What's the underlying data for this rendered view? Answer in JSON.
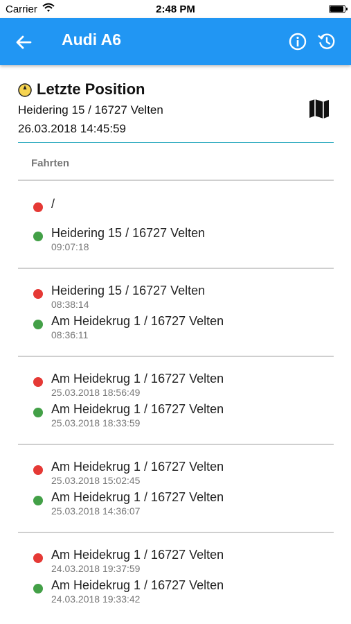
{
  "status_bar": {
    "carrier": "Carrier",
    "time": "2:48 PM",
    "battery_level": 1.0,
    "wifi_icon": "wifi-icon",
    "battery_icon": "battery-icon"
  },
  "app_bar": {
    "title": "Audi A6",
    "background_color": "#2196f3",
    "back_icon": "arrow-left-icon",
    "info_icon": "info-icon",
    "refresh_icon": "history-refresh-icon"
  },
  "last_position": {
    "title": "Letzte Position",
    "address": "Heidering 15 / 16727 Velten",
    "datetime": "26.03.2018 14:45:59",
    "status_icon": "yellow-location-icon",
    "map_icon": "map-icon",
    "accent_color": "#3ab0c3"
  },
  "trips": {
    "header": "Fahrten",
    "end_color": "#e53935",
    "start_color": "#43a047",
    "items": [
      {
        "end": {
          "address": "/",
          "time": ""
        },
        "start": {
          "address": "Heidering 15 / 16727 Velten",
          "time": "09:07:18"
        }
      },
      {
        "end": {
          "address": "Heidering 15 / 16727 Velten",
          "time": "08:38:14"
        },
        "start": {
          "address": "Am Heidekrug 1 / 16727 Velten",
          "time": "08:36:11"
        }
      },
      {
        "end": {
          "address": "Am Heidekrug 1 / 16727 Velten",
          "time": "25.03.2018 18:56:49"
        },
        "start": {
          "address": "Am Heidekrug 1 / 16727 Velten",
          "time": "25.03.2018 18:33:59"
        }
      },
      {
        "end": {
          "address": "Am Heidekrug 1 / 16727 Velten",
          "time": "25.03.2018 15:02:45"
        },
        "start": {
          "address": "Am Heidekrug 1 / 16727 Velten",
          "time": "25.03.2018 14:36:07"
        }
      },
      {
        "end": {
          "address": "Am Heidekrug 1 / 16727 Velten",
          "time": "24.03.2018 19:37:59"
        },
        "start": {
          "address": "Am Heidekrug 1 / 16727 Velten",
          "time": "24.03.2018 19:33:42"
        }
      }
    ]
  }
}
